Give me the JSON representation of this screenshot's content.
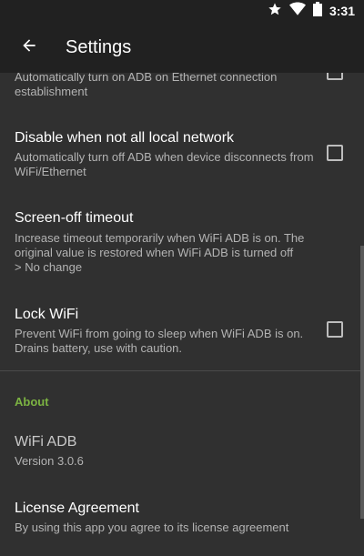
{
  "status_bar": {
    "time": "3:31",
    "icons": [
      "star-icon",
      "wifi-icon",
      "battery-icon"
    ]
  },
  "app_bar": {
    "back_icon": "arrow-left-icon",
    "title": "Settings"
  },
  "preferences": {
    "adb_on_ethernet": {
      "summary": "Automatically turn on ADB on Ethernet connection establishment",
      "checked": false
    },
    "disable_not_local": {
      "title": "Disable when not all local network",
      "summary": "Automatically turn off ADB when device disconnects from WiFi/Ethernet",
      "checked": false
    },
    "screen_off_timeout": {
      "title": "Screen-off timeout",
      "summary": "Increase timeout temporarily when WiFi ADB is on. The original value is restored when WiFi ADB is turned off",
      "value": "> No change"
    },
    "lock_wifi": {
      "title": "Lock WiFi",
      "summary": "Prevent WiFi from going to sleep when WiFi ADB is on. Drains battery, use with caution.",
      "checked": false
    }
  },
  "about": {
    "category": "About",
    "app": {
      "title": "WiFi ADB",
      "version": "Version 3.0.6"
    },
    "license": {
      "title": "License Agreement",
      "summary": "By using this app you agree to its license agreement"
    }
  },
  "colors": {
    "background": "#303030",
    "app_bar": "#212121",
    "accent": "#7cb342",
    "secondary_text": "#b3b3b3"
  }
}
